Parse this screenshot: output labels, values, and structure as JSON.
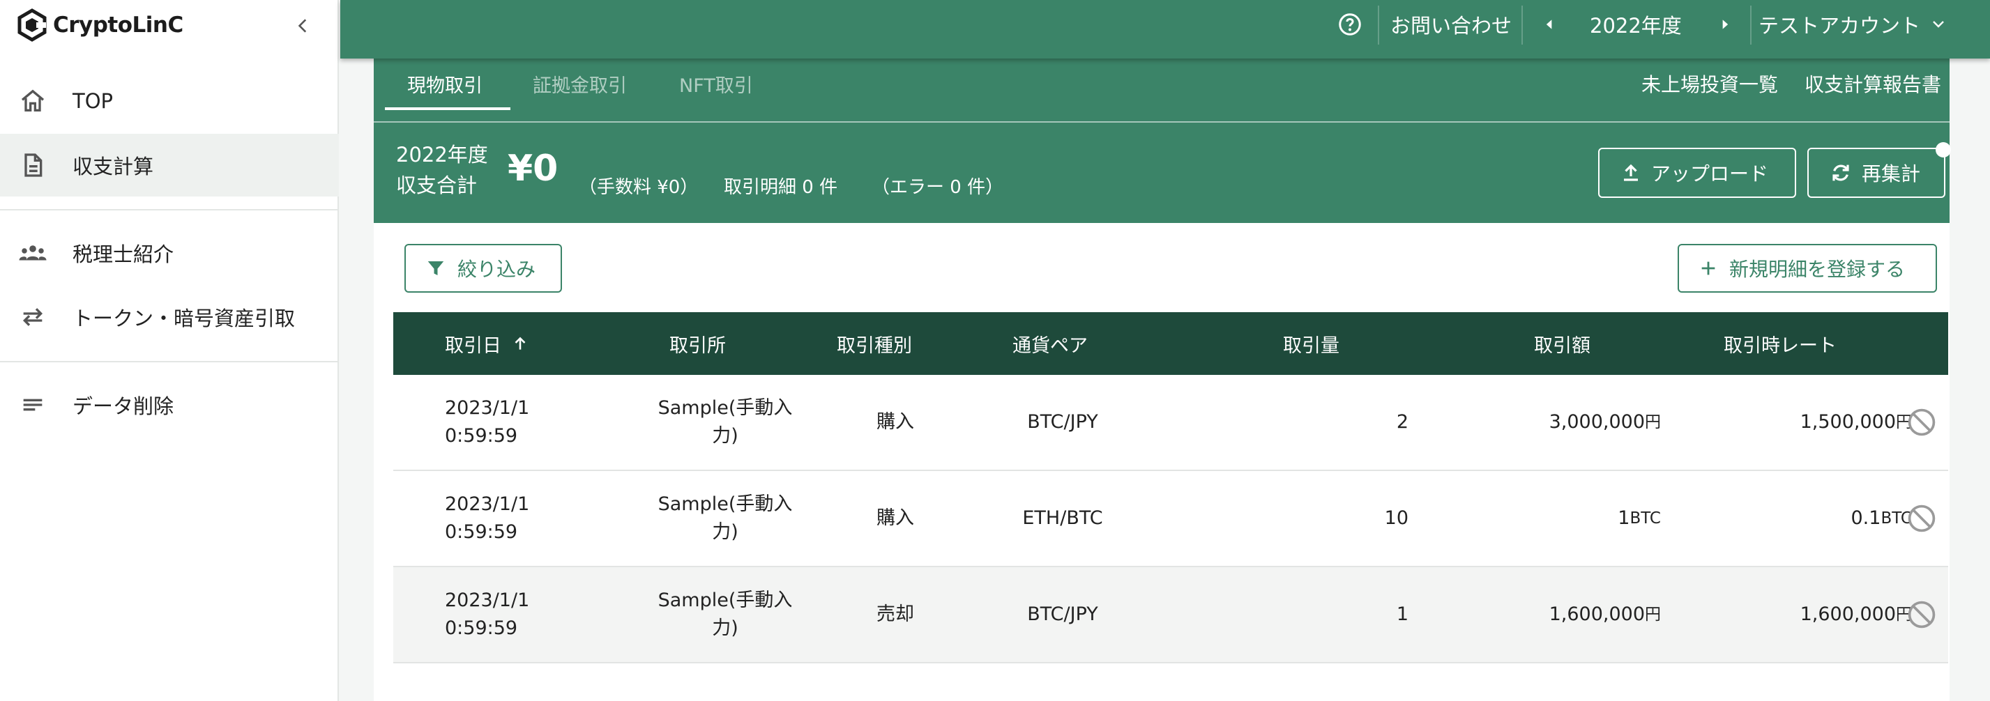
{
  "sidebar": {
    "brand": "CryptoLinC",
    "items": [
      {
        "label": "TOP",
        "icon": "home-icon"
      },
      {
        "label": "収支計算",
        "icon": "document-icon"
      },
      {
        "label": "税理士紹介",
        "icon": "people-icon"
      },
      {
        "label": "トークン・暗号資産引取",
        "icon": "swap-icon"
      },
      {
        "label": "データ削除",
        "icon": "lines-icon"
      }
    ],
    "active_index": 1
  },
  "header": {
    "contact_label": "お問い合わせ",
    "fiscal_year": "2022年度",
    "account_name": "テストアカウント"
  },
  "tabs": {
    "items": [
      "現物取引",
      "証拠金取引",
      "NFT取引"
    ],
    "active_index": 0,
    "right_links": [
      "未上場投資一覧",
      "収支計算報告書"
    ]
  },
  "summary": {
    "year_label": "2022年度",
    "total_label": "収支合計",
    "total_value": "¥0",
    "fee_text": "（手数料 ¥0）",
    "detail_text": "取引明細 0 件",
    "error_text": "（エラー 0 件）",
    "upload_label": "アップロード",
    "recalc_label": "再集計"
  },
  "toolbar": {
    "filter_label": "絞り込み",
    "add_label": "新規明細を登録する"
  },
  "table": {
    "columns": [
      "取引日",
      "取引所",
      "取引種別",
      "通貨ペア",
      "取引量",
      "取引額",
      "取引時レート"
    ],
    "rows": [
      {
        "date": "2023/1/1",
        "time": "0:59:59",
        "exchange_1": "Sample(手動入",
        "exchange_2": "力)",
        "type": "購入",
        "pair": "BTC/JPY",
        "qty": "2",
        "amount": "3,000,000",
        "amount_unit": "円",
        "rate": "1,500,000",
        "rate_unit": "円"
      },
      {
        "date": "2023/1/1",
        "time": "0:59:59",
        "exchange_1": "Sample(手動入",
        "exchange_2": "力)",
        "type": "購入",
        "pair": "ETH/BTC",
        "qty": "10",
        "amount": "1",
        "amount_unit": "BTC",
        "rate": "0.1",
        "rate_unit": "BTC"
      },
      {
        "date": "2023/1/1",
        "time": "0:59:59",
        "exchange_1": "Sample(手動入",
        "exchange_2": "力)",
        "type": "売却",
        "pair": "BTC/JPY",
        "qty": "1",
        "amount": "1,600,000",
        "amount_unit": "円",
        "rate": "1,600,000",
        "rate_unit": "円"
      }
    ]
  },
  "colors": {
    "primary": "#3b8468",
    "table_header": "#1e4a3b",
    "sidebar_active": "#eef1ef"
  }
}
